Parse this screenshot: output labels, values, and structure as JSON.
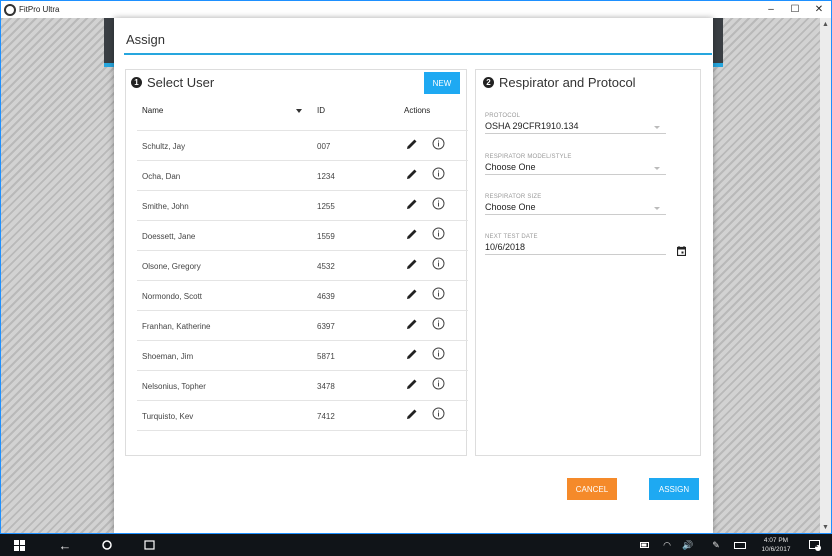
{
  "window": {
    "title": "FitPro Ultra",
    "controls": {
      "minimize": "–",
      "maximize": "☐",
      "close": "✕"
    }
  },
  "dialog": {
    "title": "Assign",
    "select_user": {
      "step": "1",
      "title": "Select User",
      "new_label": "NEW",
      "columns": {
        "name": "Name",
        "id": "ID",
        "actions": "Actions"
      },
      "users": [
        {
          "name": "Schultz, Jay",
          "id": "007"
        },
        {
          "name": "Ocha, Dan",
          "id": "1234"
        },
        {
          "name": "Smithe, John",
          "id": "1255"
        },
        {
          "name": "Doessett, Jane",
          "id": "1559"
        },
        {
          "name": "Olsone, Gregory",
          "id": "4532"
        },
        {
          "name": "Normondo, Scott",
          "id": "4639"
        },
        {
          "name": "Franhan, Katherine",
          "id": "6397"
        },
        {
          "name": "Shoeman, Jim",
          "id": "5871"
        },
        {
          "name": "Nelsonius, Topher",
          "id": "3478"
        },
        {
          "name": "Turquisto, Kev",
          "id": "7412"
        }
      ]
    },
    "respirator": {
      "step": "2",
      "title": "Respirator and Protocol",
      "fields": {
        "protocol": {
          "label": "PROTOCOL",
          "value": "OSHA 29CFR1910.134"
        },
        "model": {
          "label": "RESPIRATOR MODEL/STYLE",
          "value": "Choose One"
        },
        "size": {
          "label": "RESPIRATOR SIZE",
          "value": "Choose One"
        },
        "next_test": {
          "label": "NEXT TEST DATE",
          "value": "10/6/2018"
        }
      }
    },
    "cancel_label": "CANCEL",
    "assign_label": "ASSIGN"
  },
  "taskbar": {
    "time": "4:07 PM",
    "date": "10/6/2017",
    "notification_count": "1"
  },
  "colors": {
    "accent_blue": "#1ea9f2",
    "cancel_orange": "#f58a2a",
    "header_blue_line": "#26a6de"
  }
}
